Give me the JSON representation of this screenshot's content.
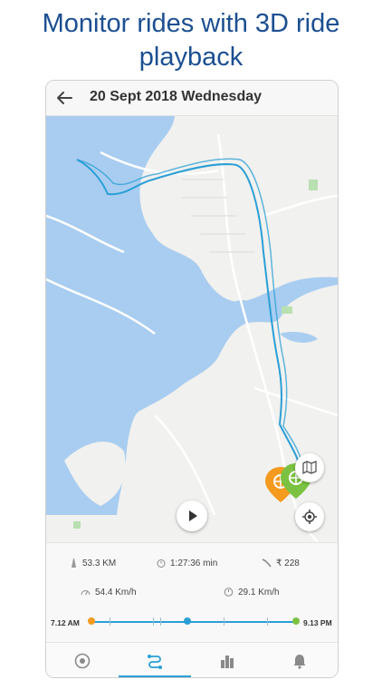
{
  "headline": "Monitor rides with 3D ride playback",
  "appbar": {
    "title": "20 Sept 2018 Wednesday",
    "back_icon": "arrow-left-icon"
  },
  "map": {
    "colors": {
      "water": "#a9cdf0",
      "land": "#f1f1ef",
      "route": "#2a9fd6",
      "park": "#b9e0b0"
    },
    "markers": [
      {
        "name": "start-marker",
        "color": "#f39a1f",
        "icon": "bicycle-wheel-icon"
      },
      {
        "name": "end-marker",
        "color": "#7cc242",
        "icon": "bicycle-wheel-icon"
      }
    ]
  },
  "controls": {
    "layers_icon": "map-layers-icon",
    "locate_icon": "crosshair-icon",
    "play_icon": "play-icon"
  },
  "stats": {
    "distance": "53.3 KM",
    "duration": "1:27:36 min",
    "cost": "₹ 228",
    "avg_speed": "54.4 Km/h",
    "speed2": "29.1 Km/h"
  },
  "timeline": {
    "start": "7.12 AM",
    "end": "9.13 PM",
    "progress": 0.47
  },
  "nav": [
    {
      "name": "nav-dashboard",
      "icon": "speedometer-icon"
    },
    {
      "name": "nav-rides",
      "icon": "route-icon",
      "active": true
    },
    {
      "name": "nav-stats",
      "icon": "bar-chart-icon"
    },
    {
      "name": "nav-alerts",
      "icon": "bell-icon"
    }
  ]
}
